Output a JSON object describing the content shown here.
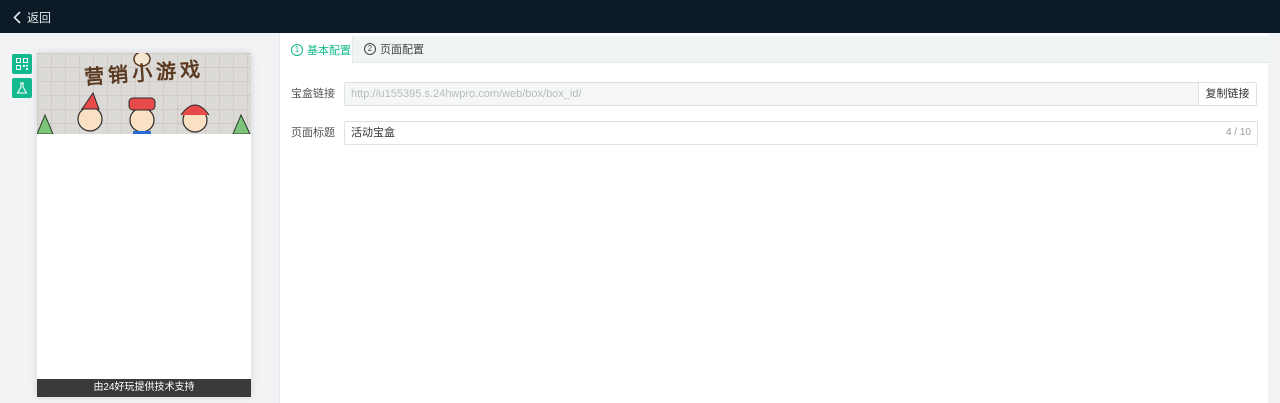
{
  "topbar": {
    "back_label": "返回"
  },
  "preview": {
    "banner_title": "营销小游戏",
    "footer": "由24好玩提供技术支持"
  },
  "tabs": [
    {
      "num": "1",
      "label": "基本配置",
      "active": true
    },
    {
      "num": "2",
      "label": "页面配置",
      "active": false
    }
  ],
  "form": {
    "link_label": "宝盒链接",
    "link_placeholder": "http://u155395.s.24hwpro.com/web/box/box_id/",
    "copy_label": "复制链接",
    "title_label": "页面标题",
    "title_value": "活动宝盒",
    "title_count": "4 / 10"
  },
  "colors": {
    "accent": "#13b98e",
    "topbar": "#0b1a26"
  }
}
